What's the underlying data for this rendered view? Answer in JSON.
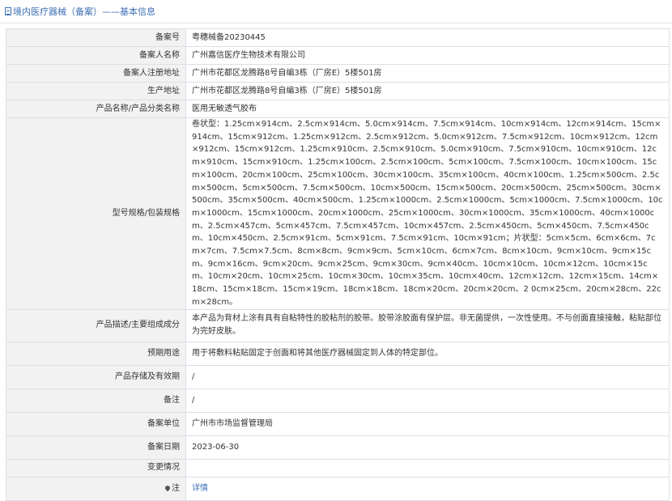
{
  "header": {
    "title": "境内医疗器械（备案）——基本信息",
    "icon": "document-icon"
  },
  "rows": [
    {
      "label": "备案号",
      "value": "粤穗械备20230445"
    },
    {
      "label": "备案人名称",
      "value": "广州嘉信医疗生物技术有限公司"
    },
    {
      "label": "备案人注册地址",
      "value": "广州市花都区龙腾路8号自编3栋（厂房E）5楼501房"
    },
    {
      "label": "生产地址",
      "value": "广州市花都区龙腾路8号自编3栋（厂房E）5楼501房"
    },
    {
      "label": "产品名称/产品分类名称",
      "value": "医用无敏透气胶布"
    },
    {
      "label": "型号规格/包装规格",
      "value": "卷状型：1.25cm×914cm、2.5cm×914cm、5.0cm×914cm、7.5cm×914cm、10cm×914cm、12cm×914cm、15cm×914cm、15cm×912cm、1.25cm×912cm、2.5cm×912cm、5.0cm×912cm、7.5cm×912cm、10cm×912cm、12cm×912cm、15cm×912cm、1.25cm×910cm、2.5cm×910cm、5.0cm×910cm、7.5cm×910cm、10cm×910cm、12cm×910cm、15cm×910cm、1.25cm×100cm、2.5cm×100cm、5cm×100cm、7.5cm×100cm、10cm×100cm、15cm×100cm、20cm×100cm、25cm×100cm、30cm×100cm、35cm×100cm、40cm×100cm、1.25cm×500cm、2.5cm×500cm、5cm×500cm、7.5cm×500cm、10cm×500cm、15cm×500cm、20cm×500cm、25cm×500cm、30cm×500cm、35cm×500cm、40cm×500cm、1.25cm×1000cm、2.5cm×1000cm、5cm×1000cm、7.5cm×1000cm、10cm×1000cm、15cm×1000cm、20cm×1000cm、25cm×1000cm、30cm×1000cm、35cm×1000cm、40cm×1000cm、2.5cm×457cm、5cm×457cm、7.5cm×457cm、10cm×457cm、2.5cm×450cm、5cm×450cm、7.5cm×450cm、10cm×450cm、2.5cm×91cm、5cm×91cm、7.5cm×91cm、10cm×91cm；片状型：5cm×5cm、6cm×6cm、7cm×7cm、7.5cm×7.5cm、8cm×8cm、9cm×9cm、5cm×10cm、6cm×7cm、8cm×10cm、9cm×10cm、9cm×15cm、9cm×16cm、9cm×20cm、9cm×25cm、9cm×30cm、9cm×40cm、10cm×10cm、10cm×12cm、10cm×15cm、10cm×20cm、10cm×25cm、10cm×30cm、10cm×35cm、10cm×40cm、12cm×12cm、12cm×15cm、14cm×18cm、15cm×18cm、15cm×19cm、18cm×18cm、18cm×20cm、20cm×20cm、2 0cm×25cm、20cm×28cm、22cm×28cm。"
    },
    {
      "label": "产品描述/主要组成成分",
      "value": "本产品为背材上涂有具有自粘特性的胶粘剂的胶带。胶带涂胶面有保护层。非无菌提供，一次性使用。不与创面直接接触，粘贴部位为完好皮肤。"
    },
    {
      "label": "预期用途",
      "value": "用于将敷料粘贴固定于创面和将其他医疗器械固定到人体的特定部位。"
    },
    {
      "label": "产品存储及有效期",
      "value": "/"
    },
    {
      "label": "备注",
      "value": "/"
    },
    {
      "label": "备案单位",
      "value": "广州市市场监督管理局"
    },
    {
      "label": "备案日期",
      "value": "2023-06-30"
    },
    {
      "label": "变更情况",
      "value": ""
    }
  ],
  "footer_row": {
    "icon": "pin-icon",
    "label": "注",
    "link_text": "详情"
  }
}
